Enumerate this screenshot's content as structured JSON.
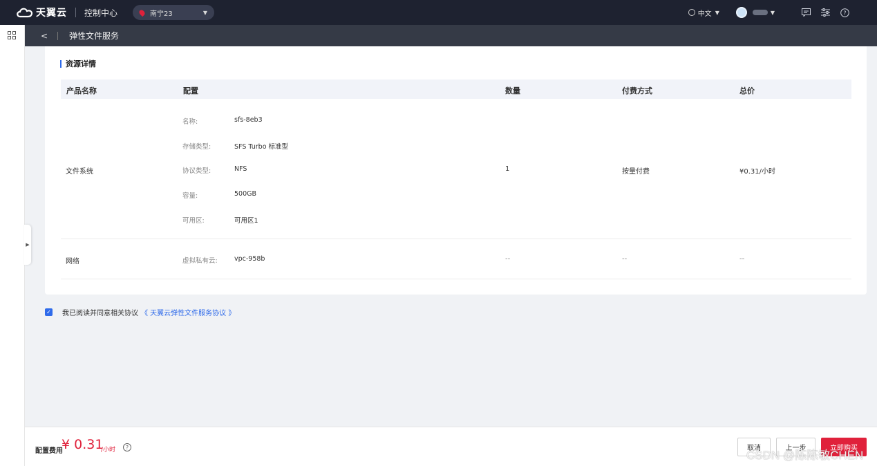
{
  "topbar": {
    "brand": "天翼云",
    "console": "控制中心",
    "region": "南宁23",
    "language": "中文"
  },
  "subheader": {
    "title": "弹性文件服务"
  },
  "details": {
    "section_title": "资源详情",
    "columns": [
      "产品名称",
      "配置",
      "数量",
      "付费方式",
      "总价"
    ],
    "rows": [
      {
        "product": "文件系统",
        "config": [
          {
            "label": "名称:",
            "value": "sfs-8eb3"
          },
          {
            "label": "存储类型:",
            "value": "SFS Turbo 标准型"
          },
          {
            "label": "协议类型:",
            "value": "NFS"
          },
          {
            "label": "容量:",
            "value": "500GB"
          },
          {
            "label": "可用区:",
            "value": "可用区1"
          }
        ],
        "quantity": "1",
        "billing": "按量付费",
        "price": "¥0.31/小时"
      },
      {
        "product": "网络",
        "config": [
          {
            "label": "虚拟私有云:",
            "value": "vpc-958b"
          }
        ],
        "quantity": "--",
        "billing": "--",
        "price": "--"
      }
    ]
  },
  "agreement": {
    "text": "我已阅读并同意相关协议",
    "link": "《 天翼云弹性文件服务协议 》",
    "checked": true
  },
  "footer": {
    "fee_label": "配置费用",
    "fee_value": "¥ 0.31",
    "fee_unit": "/小时",
    "cancel": "取消",
    "prev": "上一步",
    "buy": "立即购买"
  },
  "watermark": "CSDN @陈陈敏CHEN",
  "colors": {
    "accent": "#2f6bea",
    "brand_red": "#e0213b",
    "topbar": "#1e2230"
  }
}
